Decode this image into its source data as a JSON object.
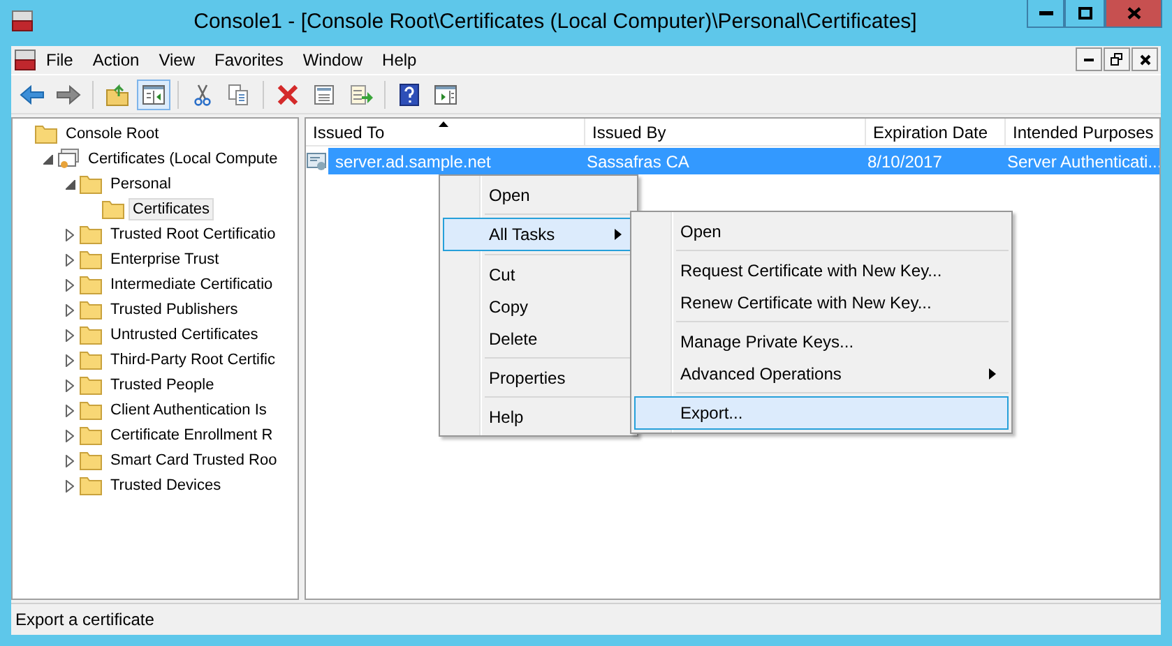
{
  "window": {
    "title": "Console1 - [Console Root\\Certificates (Local Computer)\\Personal\\Certificates]"
  },
  "menu_bar": [
    "File",
    "Action",
    "View",
    "Favorites",
    "Window",
    "Help"
  ],
  "toolbar": [
    {
      "kind": "back",
      "pressed": false
    },
    {
      "kind": "forward",
      "pressed": false
    },
    {
      "kind": "sep"
    },
    {
      "kind": "up",
      "pressed": false
    },
    {
      "kind": "tree",
      "pressed": true
    },
    {
      "kind": "sep"
    },
    {
      "kind": "cut",
      "pressed": false
    },
    {
      "kind": "copy",
      "pressed": false
    },
    {
      "kind": "sep"
    },
    {
      "kind": "delete",
      "pressed": false
    },
    {
      "kind": "properties",
      "pressed": false
    },
    {
      "kind": "export",
      "pressed": false
    },
    {
      "kind": "sep"
    },
    {
      "kind": "help",
      "pressed": false
    },
    {
      "kind": "action",
      "pressed": false
    }
  ],
  "tree": [
    {
      "label": "Console Root",
      "kind": "folder",
      "selected": false,
      "children": [
        {
          "label": "Certificates (Local Compute",
          "kind": "store",
          "expanded": true,
          "selected": false,
          "children": [
            {
              "label": "Personal",
              "kind": "folder",
              "expanded": true,
              "selected": false,
              "children": [
                {
                  "label": "Certificates",
                  "kind": "folder",
                  "selected": true
                }
              ]
            },
            {
              "label": "Trusted Root Certificatio",
              "kind": "folder",
              "expanded": false,
              "selected": false
            },
            {
              "label": "Enterprise Trust",
              "kind": "folder",
              "expanded": false,
              "selected": false
            },
            {
              "label": "Intermediate Certificatio",
              "kind": "folder",
              "expanded": false,
              "selected": false
            },
            {
              "label": "Trusted Publishers",
              "kind": "folder",
              "expanded": false,
              "selected": false
            },
            {
              "label": "Untrusted Certificates",
              "kind": "folder",
              "expanded": false,
              "selected": false
            },
            {
              "label": "Third-Party Root Certific",
              "kind": "folder",
              "expanded": false,
              "selected": false
            },
            {
              "label": "Trusted People",
              "kind": "folder",
              "expanded": false,
              "selected": false
            },
            {
              "label": "Client Authentication Is",
              "kind": "folder",
              "expanded": false,
              "selected": false
            },
            {
              "label": "Certificate Enrollment R",
              "kind": "folder",
              "expanded": false,
              "selected": false
            },
            {
              "label": "Smart Card Trusted Roo",
              "kind": "folder",
              "expanded": false,
              "selected": false
            },
            {
              "label": "Trusted Devices",
              "kind": "folder",
              "expanded": false,
              "selected": false
            }
          ]
        }
      ]
    }
  ],
  "table": {
    "columns": [
      {
        "label": "Issued To",
        "sorted": true
      },
      {
        "label": "Issued By",
        "sorted": false
      },
      {
        "label": "Expiration Date",
        "sorted": false
      },
      {
        "label": "Intended Purposes",
        "sorted": false
      }
    ],
    "rows": [
      {
        "selected": true,
        "cells": [
          "server.ad.sample.net",
          "Sassafras CA",
          "8/10/2017",
          "Server Authenticati..."
        ]
      }
    ]
  },
  "context_menu": [
    {
      "kind": "item",
      "label": "Open",
      "selected": false,
      "submenu": false
    },
    {
      "kind": "sep"
    },
    {
      "kind": "item",
      "label": "All Tasks",
      "selected": true,
      "submenu": true
    },
    {
      "kind": "sep"
    },
    {
      "kind": "item",
      "label": "Cut",
      "selected": false,
      "submenu": false
    },
    {
      "kind": "item",
      "label": "Copy",
      "selected": false,
      "submenu": false
    },
    {
      "kind": "item",
      "label": "Delete",
      "selected": false,
      "submenu": false
    },
    {
      "kind": "sep"
    },
    {
      "kind": "item",
      "label": "Properties",
      "selected": false,
      "submenu": false
    },
    {
      "kind": "sep"
    },
    {
      "kind": "item",
      "label": "Help",
      "selected": false,
      "submenu": false
    }
  ],
  "submenu": [
    {
      "kind": "item",
      "label": "Open",
      "selected": false,
      "submenu": false
    },
    {
      "kind": "sep"
    },
    {
      "kind": "item",
      "label": "Request Certificate with New Key...",
      "selected": false,
      "submenu": false
    },
    {
      "kind": "item",
      "label": "Renew Certificate with New Key...",
      "selected": false,
      "submenu": false
    },
    {
      "kind": "sep"
    },
    {
      "kind": "item",
      "label": "Manage Private Keys...",
      "selected": false,
      "submenu": false
    },
    {
      "kind": "item",
      "label": "Advanced Operations",
      "selected": false,
      "submenu": true
    },
    {
      "kind": "sep"
    },
    {
      "kind": "item",
      "label": "Export...",
      "selected": true,
      "submenu": false
    }
  ],
  "status_bar": "Export a certificate"
}
